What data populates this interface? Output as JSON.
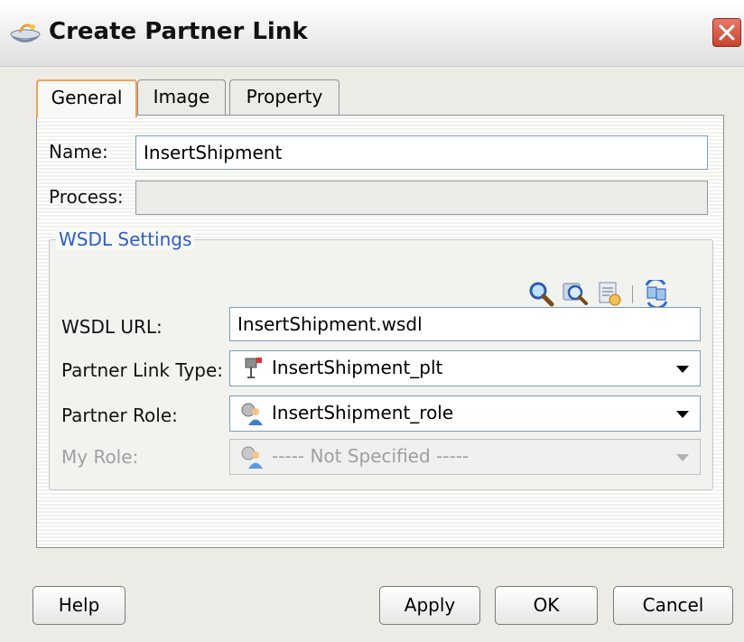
{
  "window": {
    "title": "Create Partner Link"
  },
  "tabs": [
    {
      "label": "General",
      "active": true
    },
    {
      "label": "Image",
      "active": false
    },
    {
      "label": "Property",
      "active": false
    }
  ],
  "general": {
    "name_label": "Name:",
    "name_value": "InsertShipment",
    "process_label": "Process:",
    "process_value": ""
  },
  "wsdl": {
    "group_label": "WSDL Settings",
    "toolbar_icons": [
      "search-icon",
      "browse-services-icon",
      "service-explorer-icon",
      "refresh-icon"
    ],
    "url_label": "WSDL URL:",
    "url_value": "InsertShipment.wsdl",
    "partner_link_type_label": "Partner Link Type:",
    "partner_link_type_value": "InsertShipment_plt",
    "partner_role_label": "Partner Role:",
    "partner_role_value": "InsertShipment_role",
    "my_role_label": "My Role:",
    "my_role_value": "----- Not Specified -----"
  },
  "buttons": {
    "help": "Help",
    "apply": "Apply",
    "ok": "OK",
    "cancel": "Cancel"
  },
  "colors": {
    "tab_active_border": "#e7a45a",
    "group_label": "#2d5fc4",
    "close_button": "#c8452f"
  }
}
